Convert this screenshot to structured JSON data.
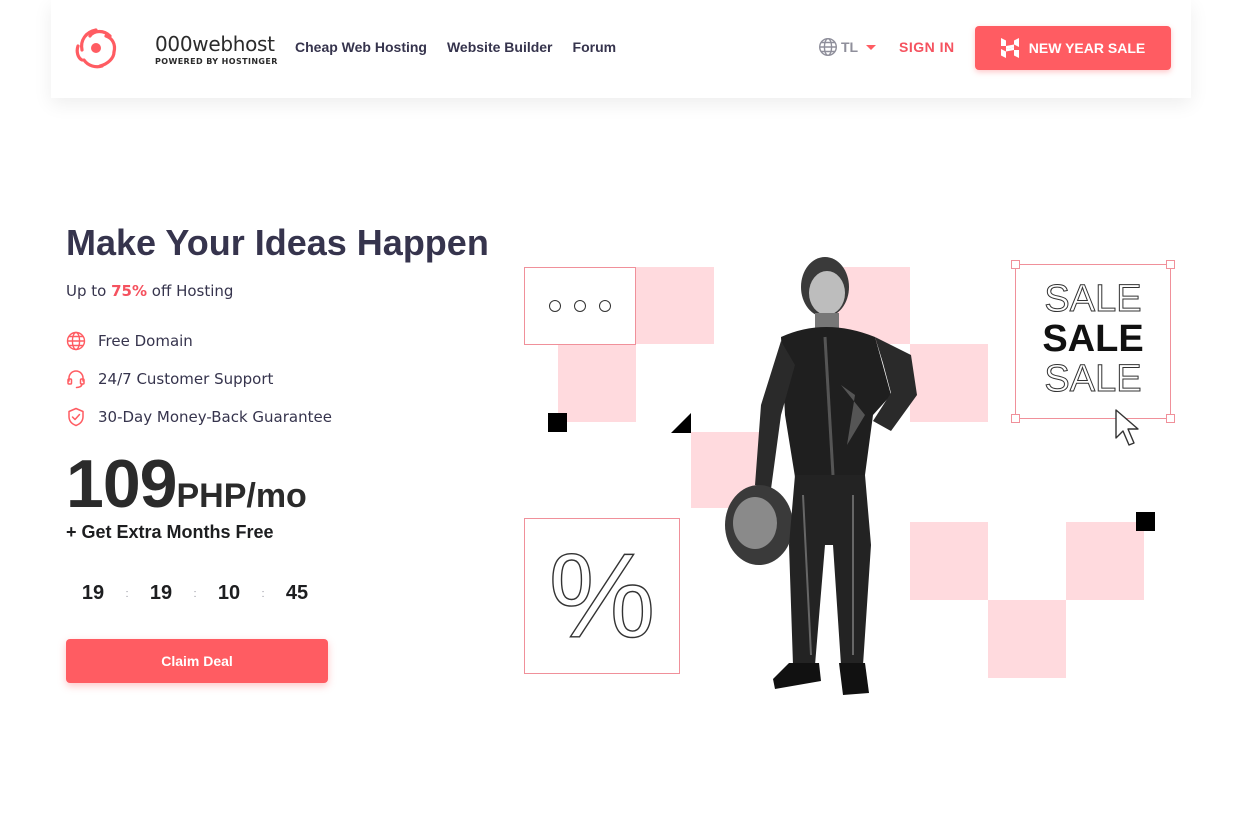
{
  "header": {
    "logo_name": "000webhost",
    "logo_sub": "POWERED BY HOSTINGER",
    "nav": [
      "Cheap Web Hosting",
      "Website Builder",
      "Forum"
    ],
    "lang": "TL",
    "sign_in": "SIGN IN",
    "sale_button": "NEW YEAR SALE"
  },
  "hero": {
    "title": "Make Your Ideas Happen",
    "sub_prefix": "Up to",
    "sub_pct": "75%",
    "sub_suffix": "off Hosting",
    "features": [
      "Free Domain",
      "24/7 Customer Support",
      "30-Day Money-Back Guarantee"
    ],
    "price": "109",
    "price_unit": "PHP/mo",
    "extra": "+ Get Extra Months Free",
    "countdown": [
      "19",
      "19",
      "10",
      "45"
    ],
    "countdown_sep": ":",
    "cta": "Claim Deal"
  },
  "art": {
    "dots": "o o o",
    "percent": "%",
    "sale_words": [
      "SALE",
      "SALE",
      "SALE"
    ]
  },
  "colors": {
    "accent": "#ff5c62",
    "pink": "#ffdade",
    "text": "#36344d"
  }
}
